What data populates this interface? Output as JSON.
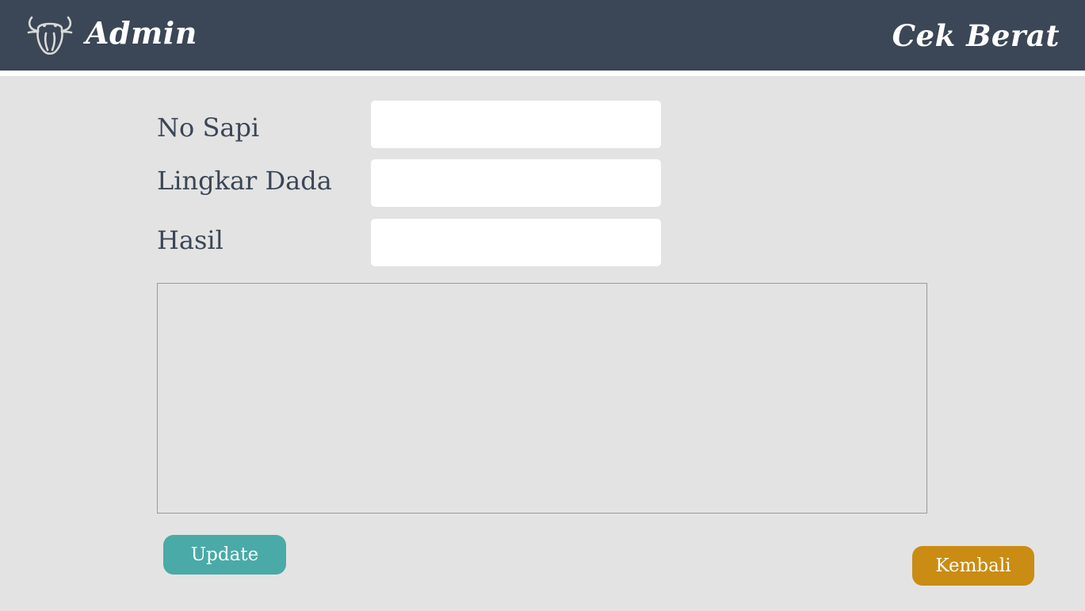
{
  "header": {
    "title": "Admin",
    "page_title": "Cek Berat",
    "logo_icon": "cow-head-icon",
    "background_color": "#3b4656"
  },
  "form": {
    "fields": [
      {
        "label": "No Sapi",
        "value": ""
      },
      {
        "label": "Lingkar Dada",
        "value": ""
      },
      {
        "label": "Hasil",
        "value": ""
      }
    ]
  },
  "buttons": {
    "update_label": "Update",
    "update_color": "#4aaaa8",
    "back_label": "Kembali",
    "back_color": "#ca8c12"
  }
}
